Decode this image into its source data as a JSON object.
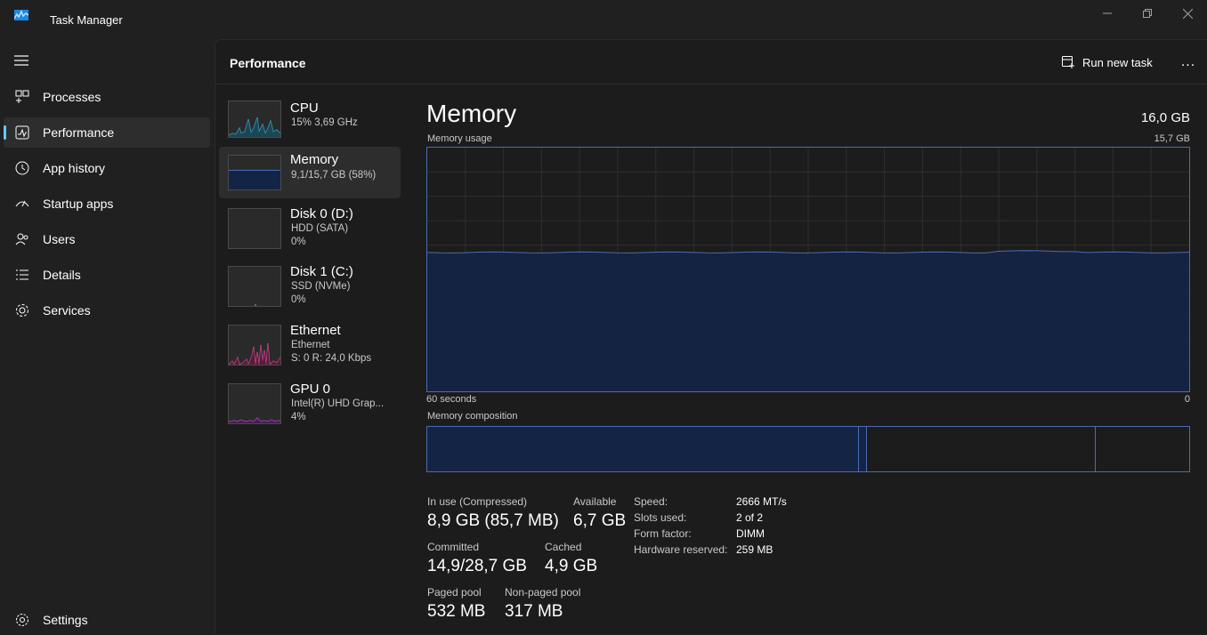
{
  "app": {
    "title": "Task Manager"
  },
  "window_controls": {
    "minimize": "minimize-icon",
    "restore": "restore-icon",
    "close": "close-icon"
  },
  "sidebar": {
    "items": [
      {
        "label": "Processes",
        "icon": "processes-icon"
      },
      {
        "label": "Performance",
        "icon": "performance-icon",
        "active": true
      },
      {
        "label": "App history",
        "icon": "history-icon"
      },
      {
        "label": "Startup apps",
        "icon": "startup-icon"
      },
      {
        "label": "Users",
        "icon": "users-icon"
      },
      {
        "label": "Details",
        "icon": "details-icon"
      },
      {
        "label": "Services",
        "icon": "services-icon"
      }
    ],
    "settings_label": "Settings"
  },
  "header": {
    "title": "Performance",
    "run_new_task": "Run new task",
    "more": "..."
  },
  "perf_list": [
    {
      "name": "CPU",
      "sub1": "15%  3,69 GHz",
      "sub2": "",
      "color": "#3ab4d8"
    },
    {
      "name": "Memory",
      "sub1": "9,1/15,7 GB (58%)",
      "sub2": "",
      "color": "#4a6bb5",
      "fill_fraction": 0.58
    },
    {
      "name": "Disk 0 (D:)",
      "sub1": "HDD (SATA)",
      "sub2": "0%",
      "color": "#8bc34a"
    },
    {
      "name": "Disk 1 (C:)",
      "sub1": "SSD (NVMe)",
      "sub2": "0%",
      "color": "#8bc34a"
    },
    {
      "name": "Ethernet",
      "sub1": "Ethernet",
      "sub2": "S: 0  R: 24,0 Kbps",
      "color": "#e0509a"
    },
    {
      "name": "GPU 0",
      "sub1": "Intel(R) UHD Grap...",
      "sub2": "4%",
      "color": "#c058c8"
    }
  ],
  "memory": {
    "title": "Memory",
    "total": "16,0 GB",
    "usage_label": "Memory usage",
    "usage_max": "15,7 GB",
    "time_left": "60 seconds",
    "time_right": "0",
    "composition_label": "Memory composition",
    "usage_fraction": 0.57,
    "stats": {
      "in_use_label": "In use (Compressed)",
      "in_use_value": "8,9 GB (85,7 MB)",
      "available_label": "Available",
      "available_value": "6,7 GB",
      "committed_label": "Committed",
      "committed_value": "14,9/28,7 GB",
      "cached_label": "Cached",
      "cached_value": "4,9 GB",
      "paged_label": "Paged pool",
      "paged_value": "532 MB",
      "nonpaged_label": "Non-paged pool",
      "nonpaged_value": "317 MB"
    },
    "specs": [
      {
        "key": "Speed:",
        "value": "2666 MT/s"
      },
      {
        "key": "Slots used:",
        "value": "2 of 2"
      },
      {
        "key": "Form factor:",
        "value": "DIMM"
      },
      {
        "key": "Hardware reserved:",
        "value": "259 MB"
      }
    ]
  },
  "colors": {
    "accent": "#60cdff",
    "memory_line": "#4a6bb5",
    "memory_fill": "#142444",
    "background": "#202020"
  }
}
